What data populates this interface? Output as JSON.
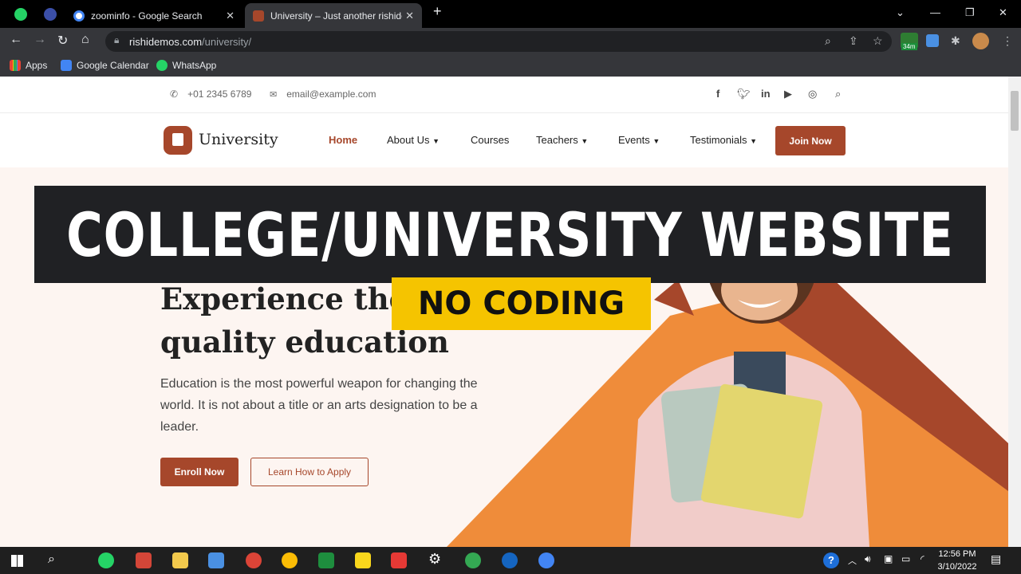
{
  "browser": {
    "tabs": [
      {
        "title": "zoominfo - Google Search"
      },
      {
        "title": "University – Just another rishiden"
      }
    ],
    "address": {
      "host": "rishidemos.com",
      "path": "/university/"
    },
    "bookmarks": [
      "Apps",
      "Google Calendar",
      "WhatsApp"
    ],
    "extension_badge": "34m"
  },
  "site": {
    "topbar": {
      "phone": "+01 2345 6789",
      "email": "email@example.com"
    },
    "logo": "University",
    "menu": [
      "Home",
      "About Us",
      "Courses",
      "Teachers",
      "Events",
      "Testimonials"
    ],
    "join_label": "Join Now",
    "hero": {
      "title_line1": "Experience the",
      "title_line2": "quality education",
      "description": "Education is the most powerful weapon for changing the world. It is not about a title or an arts designation to be a leader.",
      "enroll_label": "Enroll Now",
      "learn_label": "Learn How to Apply"
    }
  },
  "overlay": {
    "banner": "COLLEGE/UNIVERSITY WEBSITE",
    "tag": "NO CODING"
  },
  "taskbar": {
    "time": "12:56 PM",
    "date": "3/10/2022"
  },
  "colors": {
    "brand": "#a6472b",
    "hero_bg": "#fdf5f1",
    "accent_orange": "#ef8c3a",
    "banner_bg": "#202124",
    "tag_bg": "#f5c400"
  }
}
